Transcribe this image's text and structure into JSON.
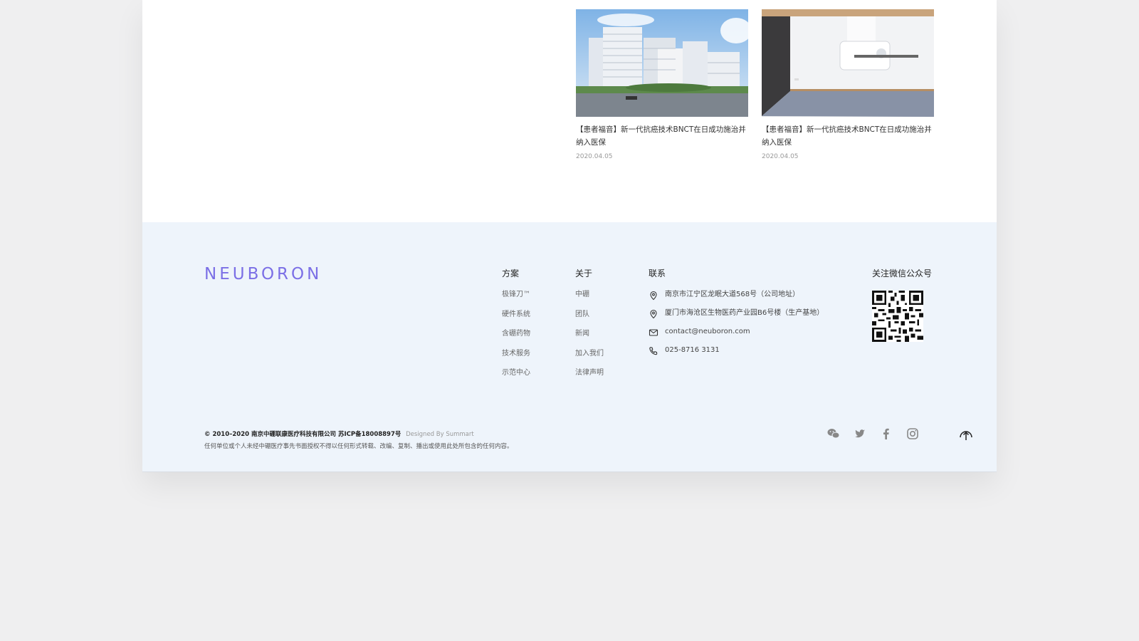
{
  "news": [
    {
      "title": "【患者福音】新一代抗癌技术BNCT在日成功施治并纳入医保",
      "date": "2020.04.05"
    },
    {
      "title": "【患者福音】新一代抗癌技术BNCT在日成功施治并纳入医保",
      "date": "2020.04.05"
    }
  ],
  "footer": {
    "logo": "NEUBORON",
    "solutions": {
      "title": "方案",
      "items": [
        "极锋刀™",
        "硬件系统",
        "含硼药物",
        "技术服务",
        "示范中心"
      ]
    },
    "about": {
      "title": "关于",
      "items": [
        "中硼",
        "团队",
        "新闻",
        "加入我们",
        "法律声明"
      ]
    },
    "contact": {
      "title": "联系",
      "address1": "南京市江宁区龙眠大道568号（公司地址）",
      "address2": "厦门市海沧区生物医药产业园B6号楼（生产基地）",
      "email": "contact@neuboron.com",
      "phone": "025-8716 3131"
    },
    "wechat": {
      "title": "关注微信公众号"
    },
    "copyright": "© 2010–2020 南京中硼联康医疗科技有限公司  苏ICP备18008897号",
    "designed": "Designed By Summart",
    "disclaimer": "任何单位或个人未经中硼医疗事先书面授权不得以任何形式转载、改编、复制、播出或使用此处所包含的任何内容。",
    "colors": {
      "brand": "#7b6fe6",
      "footer_bg": "#eef4fb"
    }
  }
}
